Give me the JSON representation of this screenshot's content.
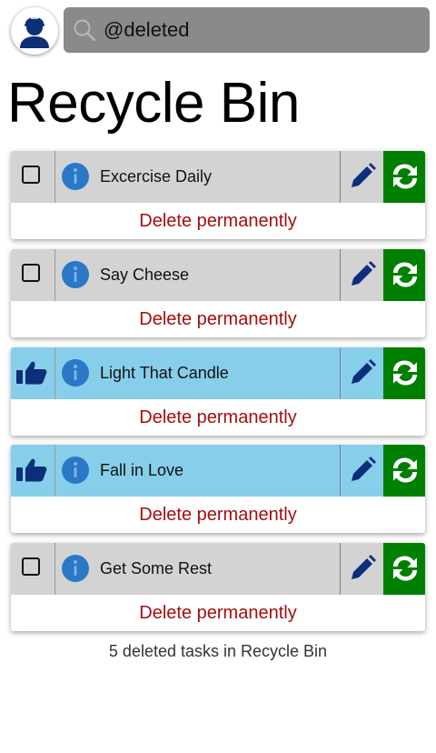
{
  "search": {
    "value": "@deleted",
    "placeholder": ""
  },
  "page": {
    "title": "Recycle Bin"
  },
  "tasks": [
    {
      "title": "Excercise Daily",
      "status": "unchecked",
      "delete_label": "Delete permanently"
    },
    {
      "title": "Say Cheese",
      "status": "unchecked",
      "delete_label": "Delete permanently"
    },
    {
      "title": "Light That Candle",
      "status": "liked",
      "delete_label": "Delete permanently"
    },
    {
      "title": "Fall in Love",
      "status": "liked",
      "delete_label": "Delete permanently"
    },
    {
      "title": "Get Some Rest",
      "status": "unchecked",
      "delete_label": "Delete permanently"
    }
  ],
  "footer": {
    "text": "5 deleted tasks in Recycle Bin"
  },
  "icons": {
    "avatar": "user-avatar-icon",
    "search": "search-icon",
    "info": "info-icon",
    "edit": "pencil-icon",
    "restore": "restore-sync-icon",
    "liked": "thumbs-up-icon",
    "unchecked": "checkbox-icon"
  },
  "colors": {
    "search_bg": "#8a8a8a",
    "row_gray": "#d3d3d3",
    "row_blue": "#87ceeb",
    "restore_green": "#008000",
    "delete_red": "#a50e0e",
    "icon_navy": "#0d2f7a",
    "info_blue": "#2a78c7"
  }
}
